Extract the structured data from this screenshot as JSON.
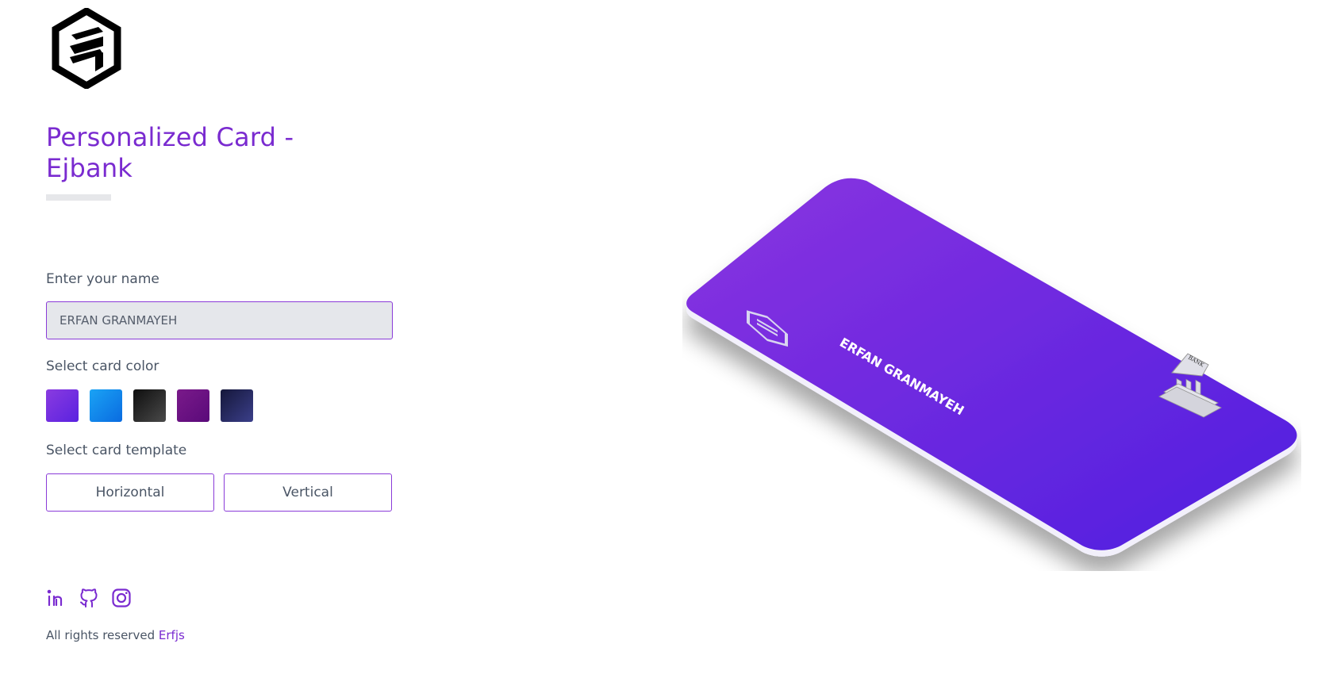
{
  "header": {
    "logo_icon": "ej-hexagon-logo-icon",
    "title": "Personalized Card - Ejbank"
  },
  "form": {
    "name_label": "Enter your name",
    "name_value": "ERFAN GRANMAYEH",
    "color_label": "Select card color",
    "colors": [
      {
        "name": "purple-gradient",
        "from": "#8a3be0",
        "to": "#5a22e0"
      },
      {
        "name": "blue-gradient",
        "from": "#1aa3f5",
        "to": "#0a6be0"
      },
      {
        "name": "black-gradient",
        "from": "#0e0e0e",
        "to": "#4a4a4a"
      },
      {
        "name": "plum-gradient",
        "from": "#7a1a8a",
        "to": "#5a0a7a"
      },
      {
        "name": "navy-gradient",
        "from": "#15173a",
        "to": "#3b3f8a"
      }
    ],
    "template_label": "Select card template",
    "templates": [
      "Horizontal",
      "Vertical"
    ]
  },
  "social": {
    "icons": [
      "linkedin-icon",
      "github-icon",
      "instagram-icon"
    ]
  },
  "footer": {
    "text": "All rights reserved",
    "link": "Erfjs"
  },
  "card": {
    "holder_name": "ERFAN GRANMAYEH",
    "bank_label": "BANK",
    "gradient_from": "#8a33e0",
    "gradient_to": "#4f1fe0",
    "logo_icon": "ej-hexagon-logo-icon",
    "bank_icon": "bank-building-icon"
  },
  "colors": {
    "accent": "#7a2bd0",
    "text": "#4a5565",
    "input_bg": "#e5e7eb"
  }
}
